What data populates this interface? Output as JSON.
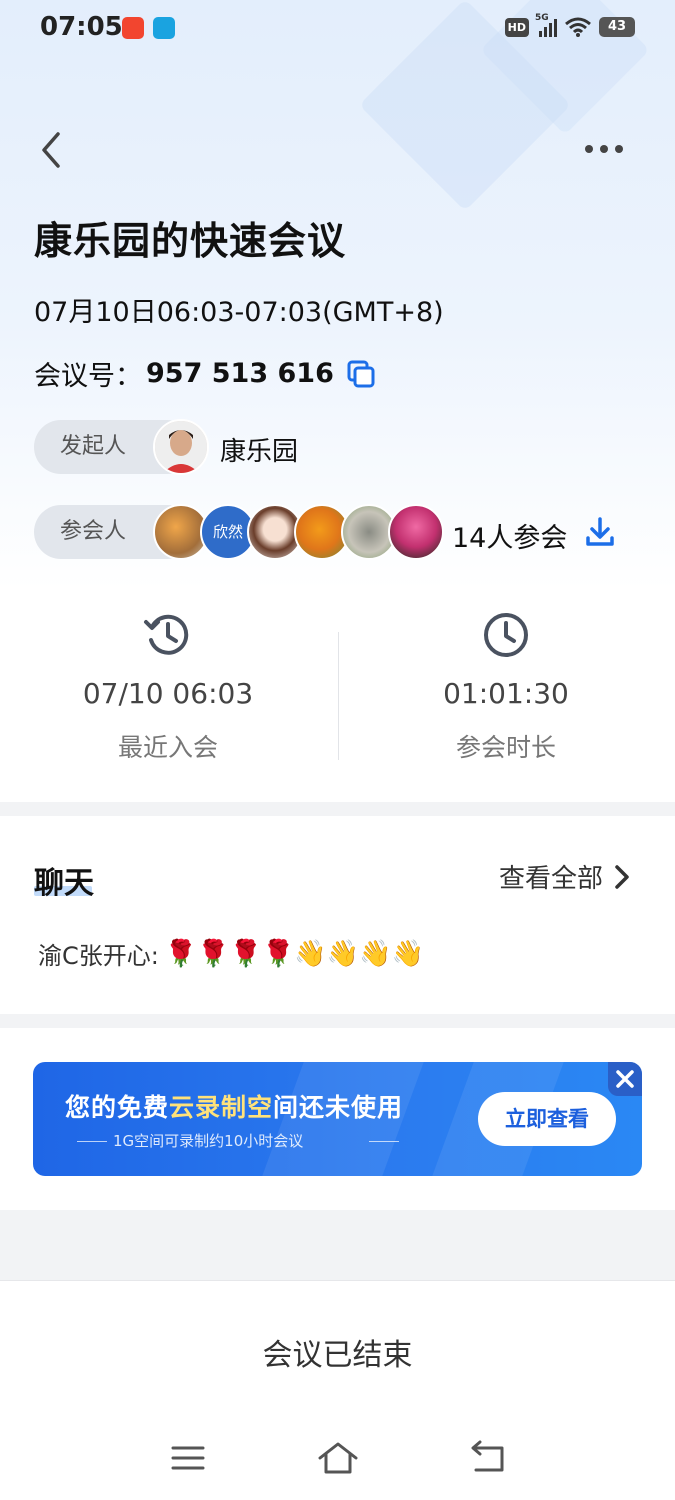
{
  "status_bar": {
    "time": "07:05",
    "hd": "HD",
    "network": "5G",
    "battery": "43",
    "app_icons": [
      "red-app-icon",
      "blue-app-icon"
    ]
  },
  "header": {
    "back_icon": "chevron-left-icon",
    "more_icon": "more-dots-icon"
  },
  "meeting": {
    "title": "康乐园的快速会议",
    "datetime": "07月10日06:03-07:03(GMT+8)",
    "id_label": "会议号：",
    "id_value": "957 513 616",
    "host_label": "发起人",
    "host_name": "康乐园",
    "participants_label": "参会人",
    "participant_text_avatar": "欣然",
    "participants_count": "14人参会"
  },
  "stats": {
    "last_join": {
      "value": "07/10 06:03",
      "label": "最近入会"
    },
    "duration": {
      "value": "01:01:30",
      "label": "参会时长"
    }
  },
  "chat": {
    "title": "聊天",
    "view_all": "查看全部",
    "message_sender": "渝C张开心:",
    "message_content": "🌹🌹🌹🌹👋👋👋👋"
  },
  "banner": {
    "title_part1": "您的免费",
    "title_highlight": "云录制空",
    "title_part2": "间还未使用",
    "subtitle": "1G空间可录制约10小时会议",
    "button": "立即查看"
  },
  "footer": {
    "ended_text": "会议已结束"
  },
  "colors": {
    "accent": "#1c6ee8",
    "banner_highlight": "#ffe27a",
    "pill_bg": "#e2e6ec"
  }
}
